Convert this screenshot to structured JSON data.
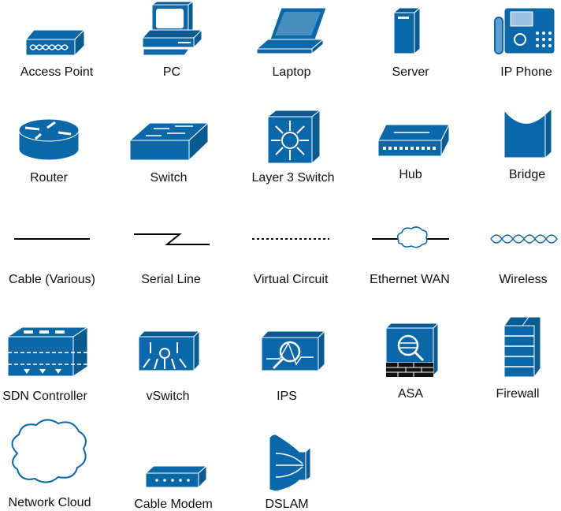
{
  "colors": {
    "icon_blue": "#0b68a8",
    "line": "#000000"
  },
  "icons": [
    {
      "label": "Access Point",
      "icon": "access-point-icon"
    },
    {
      "label": "PC",
      "icon": "pc-icon"
    },
    {
      "label": "Laptop",
      "icon": "laptop-icon"
    },
    {
      "label": "Server",
      "icon": "server-icon"
    },
    {
      "label": "IP Phone",
      "icon": "ip-phone-icon"
    },
    {
      "label": "Router",
      "icon": "router-icon"
    },
    {
      "label": "Switch",
      "icon": "switch-icon"
    },
    {
      "label": "Layer 3 Switch",
      "icon": "layer3-switch-icon"
    },
    {
      "label": "Hub",
      "icon": "hub-icon"
    },
    {
      "label": "Bridge",
      "icon": "bridge-icon"
    },
    {
      "label": "Cable (Various)",
      "icon": "cable-icon"
    },
    {
      "label": "Serial Line",
      "icon": "serial-line-icon"
    },
    {
      "label": "Virtual Circuit",
      "icon": "virtual-circuit-icon"
    },
    {
      "label": "Ethernet WAN",
      "icon": "ethernet-wan-icon"
    },
    {
      "label": "Wireless",
      "icon": "wireless-icon"
    },
    {
      "label": "SDN Controller",
      "icon": "sdn-controller-icon"
    },
    {
      "label": "vSwitch",
      "icon": "vswitch-icon"
    },
    {
      "label": "IPS",
      "icon": "ips-icon"
    },
    {
      "label": "ASA",
      "icon": "asa-icon"
    },
    {
      "label": "Firewall",
      "icon": "firewall-icon"
    },
    {
      "label": "Network Cloud",
      "icon": "network-cloud-icon"
    },
    {
      "label": "Cable Modem",
      "icon": "cable-modem-icon"
    },
    {
      "label": "DSLAM",
      "icon": "dslam-icon"
    }
  ]
}
